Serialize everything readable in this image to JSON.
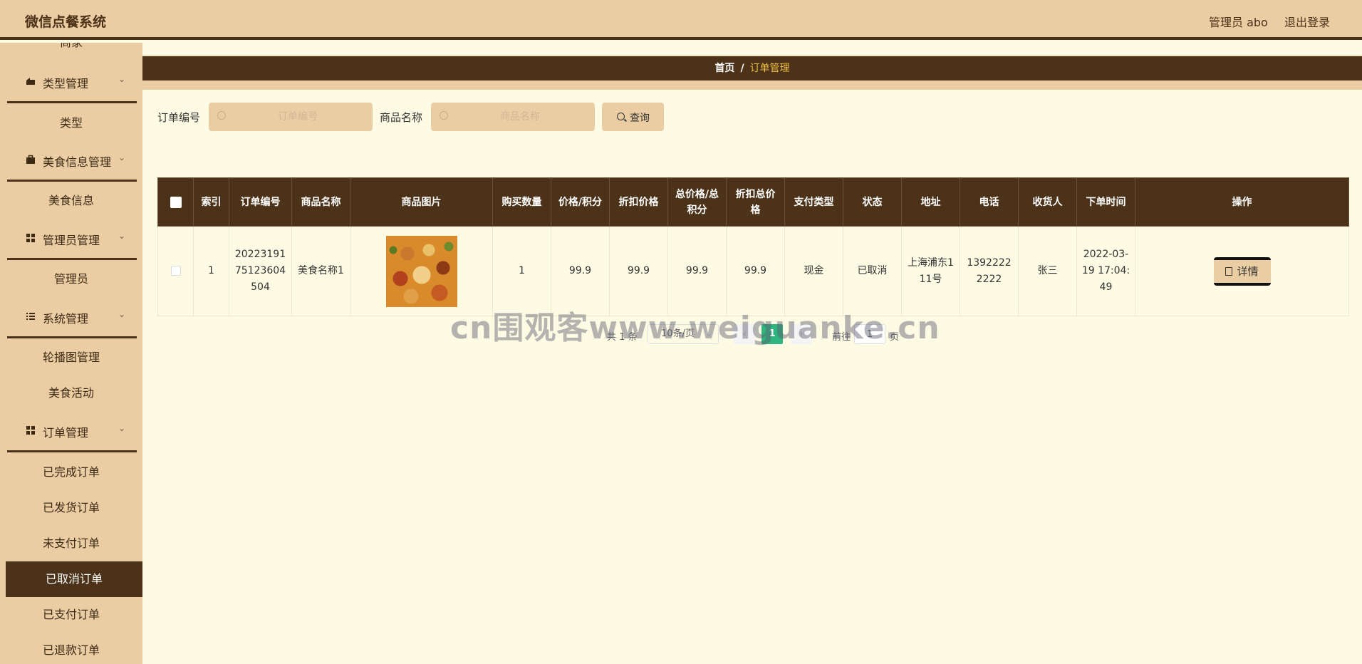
{
  "header": {
    "app_title": "微信点餐系统",
    "admin_label": "管理员 abo",
    "logout": "退出登录"
  },
  "sidebar": {
    "clipped_item": "商家",
    "groups": [
      {
        "label": "类型管理",
        "icon": "tag-icon",
        "items": [
          "类型"
        ]
      },
      {
        "label": "美食信息管理",
        "icon": "briefcase-icon",
        "items": [
          "美食信息"
        ]
      },
      {
        "label": "管理员管理",
        "icon": "grid-icon",
        "items": [
          "管理员"
        ]
      },
      {
        "label": "系统管理",
        "icon": "list-icon",
        "items": [
          "轮播图管理",
          "美食活动"
        ]
      },
      {
        "label": "订单管理",
        "icon": "grid-icon",
        "items": [
          "已完成订单",
          "已发货订单",
          "未支付订单",
          "已取消订单",
          "已支付订单",
          "已退款订单"
        ]
      }
    ],
    "active_item": "已取消订单"
  },
  "breadcrumb": {
    "home": "首页",
    "separator": "/",
    "current": "订单管理"
  },
  "search": {
    "order_no_label": "订单编号",
    "order_no_placeholder": "订单编号",
    "order_no_value": "",
    "product_label": "商品名称",
    "product_placeholder": "商品名称",
    "product_value": "",
    "query_button": "查询"
  },
  "table": {
    "headers": [
      "索引",
      "订单编号",
      "商品名称",
      "商品图片",
      "购买数量",
      "价格/积分",
      "折扣价格",
      "总价格/总积分",
      "折扣总价格",
      "支付类型",
      "状态",
      "地址",
      "电话",
      "收货人",
      "下单时间",
      "操作"
    ],
    "rows": [
      {
        "index": "1",
        "order_no": "2022319175123604504",
        "product": "美食名称1",
        "quantity": "1",
        "price": "99.9",
        "discount_price": "99.9",
        "total": "99.9",
        "discount_total": "99.9",
        "payment_type": "现金",
        "status": "已取消",
        "address": "上海浦东111号",
        "phone": "13922222222",
        "receiver": "张三",
        "order_time": "2022-03-19 17:04:49",
        "action": "详情"
      }
    ]
  },
  "pagination": {
    "total": "共 1 条",
    "page_size": "10条/页",
    "prev": "‹",
    "current_page": "1",
    "next": "›",
    "goto": "前往",
    "goto_value": "1",
    "page_suffix": "页"
  },
  "watermark": "cn围观客www.weiguanke.cn",
  "colors": {
    "primary_dark": "#4b3218",
    "primary_light": "#ebcda3",
    "background": "#fdfbe4",
    "page_active": "#2fb67f",
    "breadcrumb_current": "#f0c040"
  }
}
